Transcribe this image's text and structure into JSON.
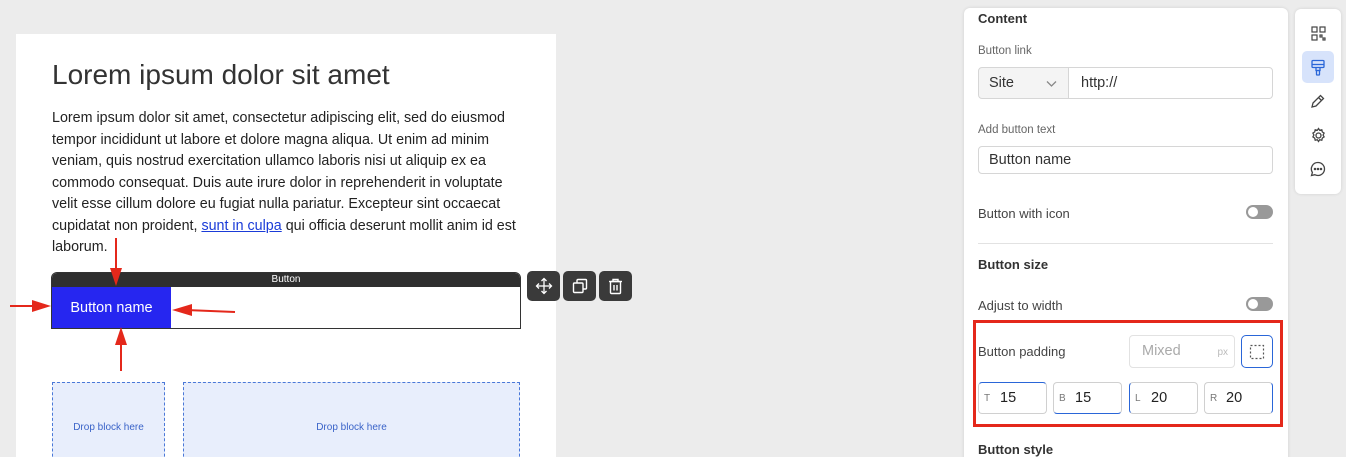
{
  "canvas": {
    "heading": "Lorem ipsum dolor sit amet",
    "paragraph_before_link": "Lorem ipsum dolor sit amet, consectetur adipiscing elit, sed do eiusmod tempor incididunt ut labore et dolore magna aliqua. Ut enim ad minim veniam, quis nostrud exercitation ullamco laboris nisi ut aliquip ex ea commodo consequat. Duis aute irure dolor in reprehenderit in voluptate velit esse cillum dolore eu fugiat nulla pariatur. Excepteur sint occaecat cupidatat non proident, ",
    "link_text": "sunt in culpa",
    "paragraph_after_link": " qui officia deserunt mollit anim id est laborum.",
    "button_block_label": "Button",
    "button_label": "Button name",
    "drop_left": "Drop block here",
    "drop_right": "Drop block here"
  },
  "block_tools": {
    "move_icon": "move-icon",
    "duplicate_icon": "duplicate-icon",
    "delete_icon": "trash-icon"
  },
  "panel": {
    "content_title": "Content",
    "button_link_label": "Button link",
    "link_type_value": "Site",
    "link_url_value": "http://",
    "button_text_label": "Add button text",
    "button_text_value": "Button name",
    "with_icon_label": "Button with icon",
    "with_icon_on": false,
    "size_title": "Button size",
    "adjust_width_label": "Adjust to width",
    "adjust_width_on": false,
    "padding_label": "Button padding",
    "padding_mixed_placeholder": "Mixed",
    "padding_unit": "px",
    "padding": {
      "top_label": "T",
      "top_value": "15",
      "bottom_label": "B",
      "bottom_value": "15",
      "left_label": "L",
      "left_value": "20",
      "right_label": "R",
      "right_value": "20"
    },
    "style_title": "Button style"
  },
  "sidebar": {
    "items": [
      "qr-grid-icon",
      "paint-brush-icon",
      "pen-icon",
      "gear-icon",
      "chat-bubble-icon"
    ],
    "active": "paint-brush-icon"
  },
  "colors": {
    "button_blue": "#2626f0",
    "highlight_red": "#e4281b",
    "accent_blue": "#2a66d8"
  }
}
